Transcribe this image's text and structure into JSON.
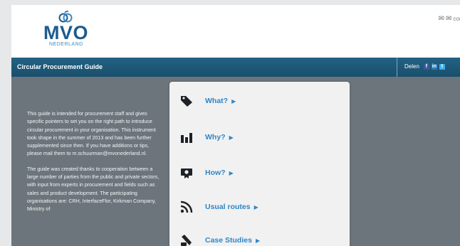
{
  "header": {
    "logo_text": "MVO",
    "logo_subtext": "NEDERLAND",
    "contact_label": "conta"
  },
  "titlebar": {
    "title": "Circular Procurement Guide",
    "share_label": "Delen"
  },
  "intro": {
    "paragraphs": [
      "This guide is intended for procurement staff and gives specific pointers to set you on the right path to introduce circular procurement in your organisation. This instrument took shape in the summer of 2013 and has been further supplemented since then. If you have additions or tips, please mail them to m.schuurman@mvonederland.nl.",
      "The guide was created thanks to cooperation between a large number of parties from the public and private sectors, with input from experts in procurement and fields such as sales and product development. The participating organisations are: CRH, InterfaceFlor, Kirkman Company, Ministry of"
    ]
  },
  "menu": {
    "items": [
      {
        "label": "What?",
        "icon": "tag-icon"
      },
      {
        "label": "Why?",
        "icon": "bar-chart-icon"
      },
      {
        "label": "How?",
        "icon": "certificate-icon"
      },
      {
        "label": "Usual routes",
        "icon": "rss-icon"
      },
      {
        "label": "Case Studies",
        "icon": "wrench-icon"
      }
    ],
    "arrow": "▶"
  },
  "colors": {
    "link": "#2f86c6",
    "titlebar": "#1f5b7a",
    "content_bg": "#6c757b",
    "logo": "#1d5c8e"
  }
}
